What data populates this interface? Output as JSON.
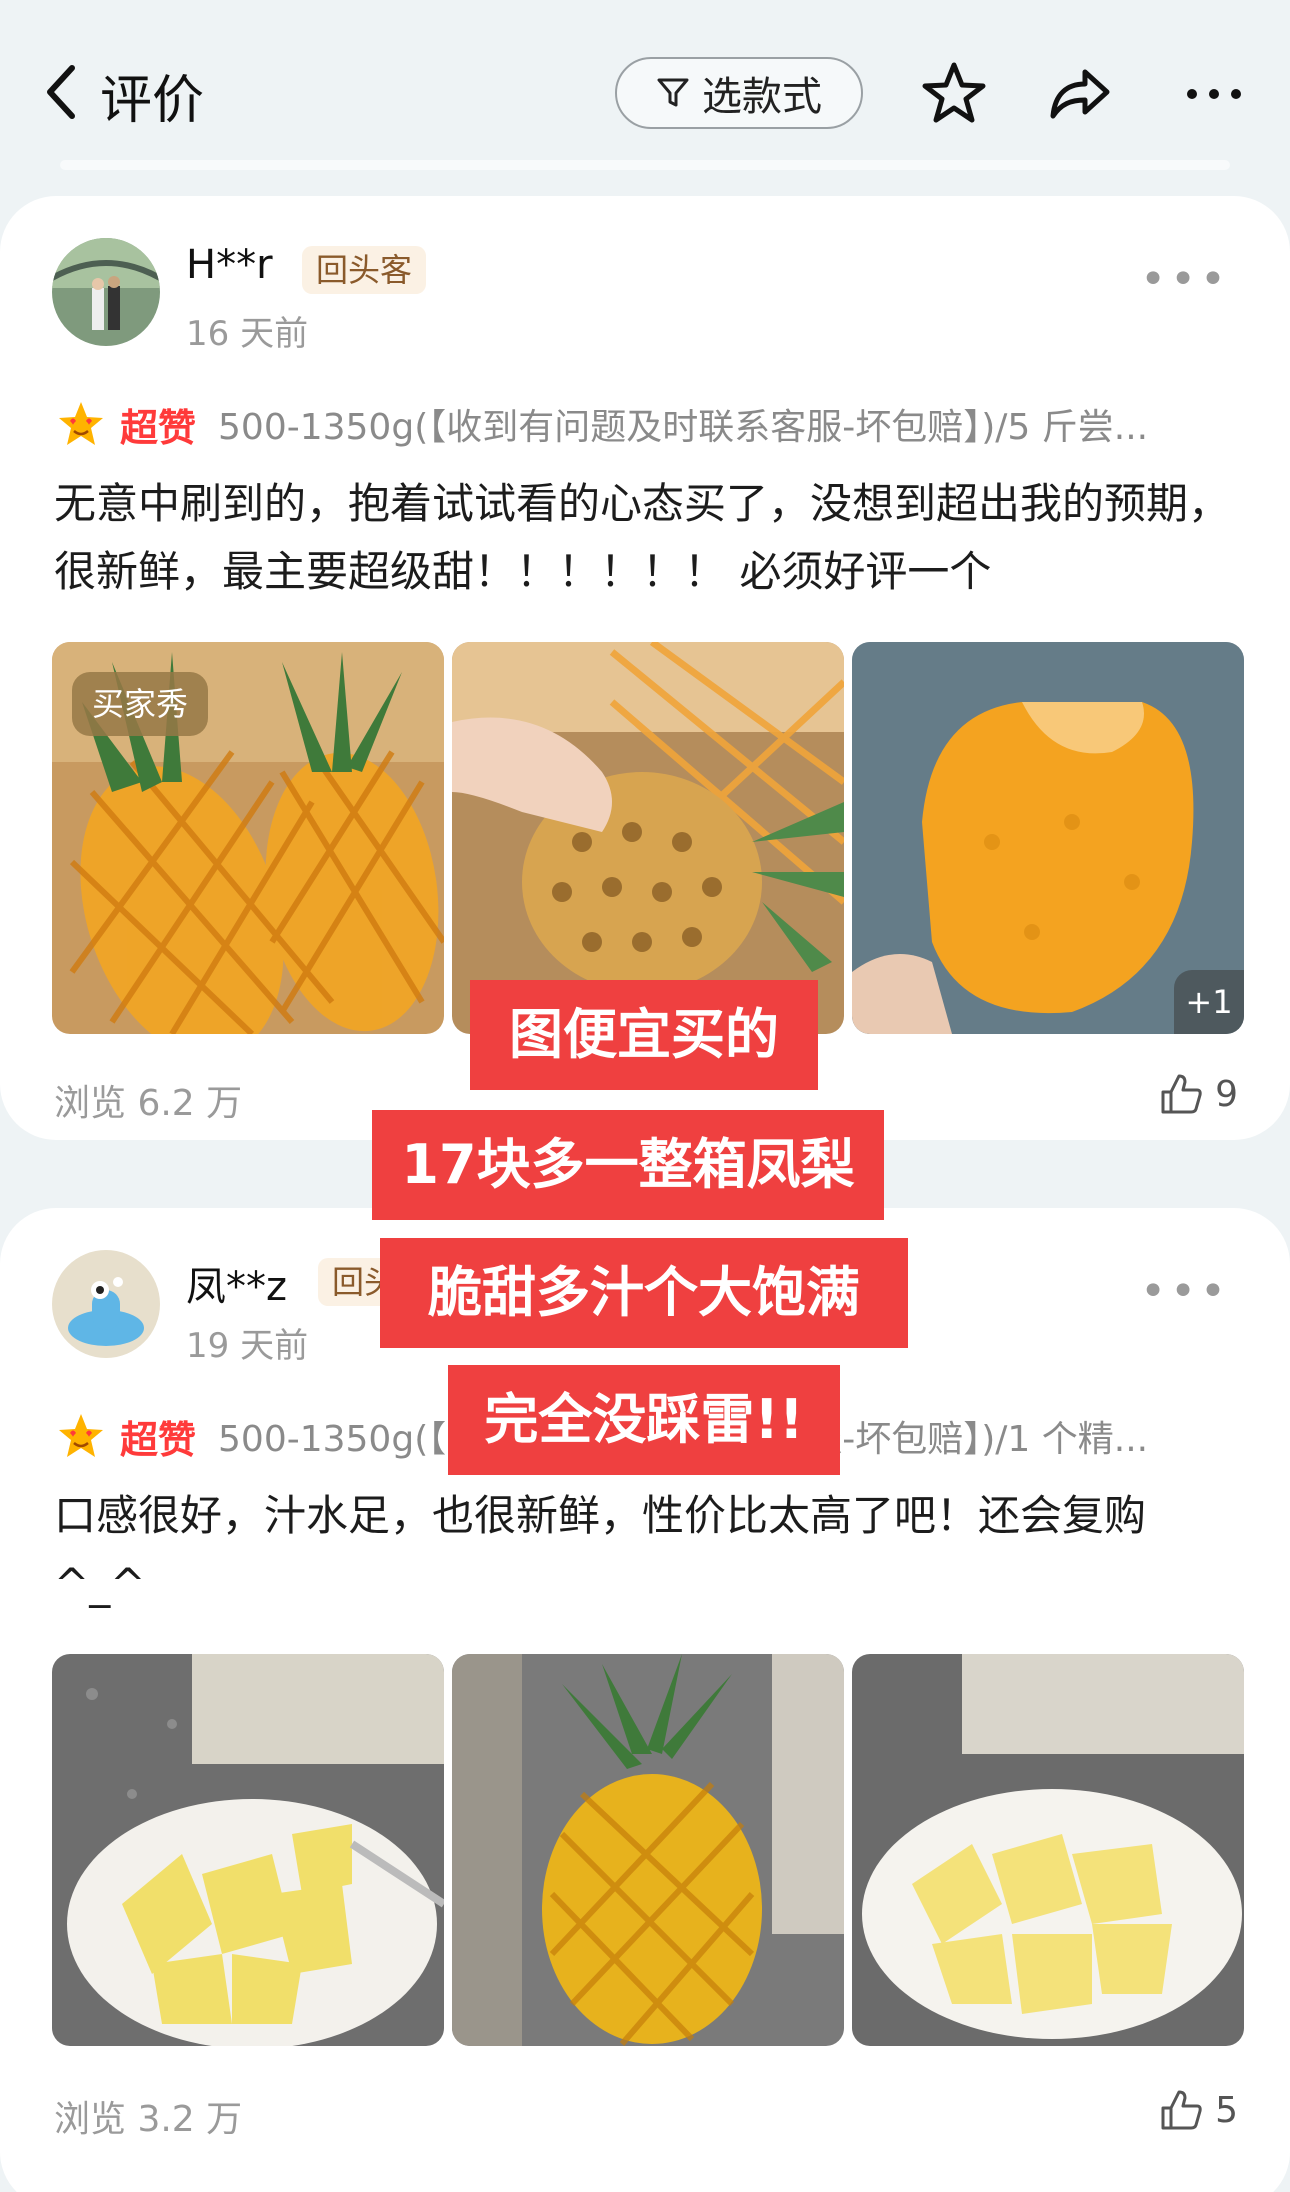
{
  "header": {
    "title": "评价",
    "filter_label": "选款式",
    "icons": [
      "back-icon",
      "filter-icon",
      "star-icon",
      "share-icon",
      "more-icon"
    ]
  },
  "reviews": [
    {
      "user": "H**r",
      "badge": "回头客",
      "time": "16 天前",
      "rating_label": "超赞",
      "spec": "500-1350g(【收到有问题及时联系客服-坏包赔】)/5 斤尝...",
      "text": "无意中刷到的，抱着试试看的心态买了，没想到超出我的预期，很新鲜，最主要超级甜！！！！！！ 必须好评一个",
      "photo_tag": "买家秀",
      "more_photos": "+1",
      "views": "浏览 6.2 万",
      "likes": "9"
    },
    {
      "user": "凤**z",
      "badge": "回头客",
      "time": "19 天前",
      "rating_label": "超赞",
      "spec": "500-1350g(【收到有问题及时联系客服-坏包赔】)/1 个精...",
      "text": "口感很好，汁水足，也很新鲜，性价比太高了吧！还会复购^_^",
      "views": "浏览 3.2 万",
      "likes": "5"
    }
  ],
  "overlay": {
    "lines": [
      "图便宜买的",
      "17块多一整箱凤梨",
      "脆甜多汁个大饱满",
      "完全没踩雷!!"
    ],
    "color": "#ef4040"
  },
  "colors": {
    "accent_red": "#ff3a3a",
    "badge_bg": "#fbf1e4",
    "page_bg": "#eef3f5"
  }
}
